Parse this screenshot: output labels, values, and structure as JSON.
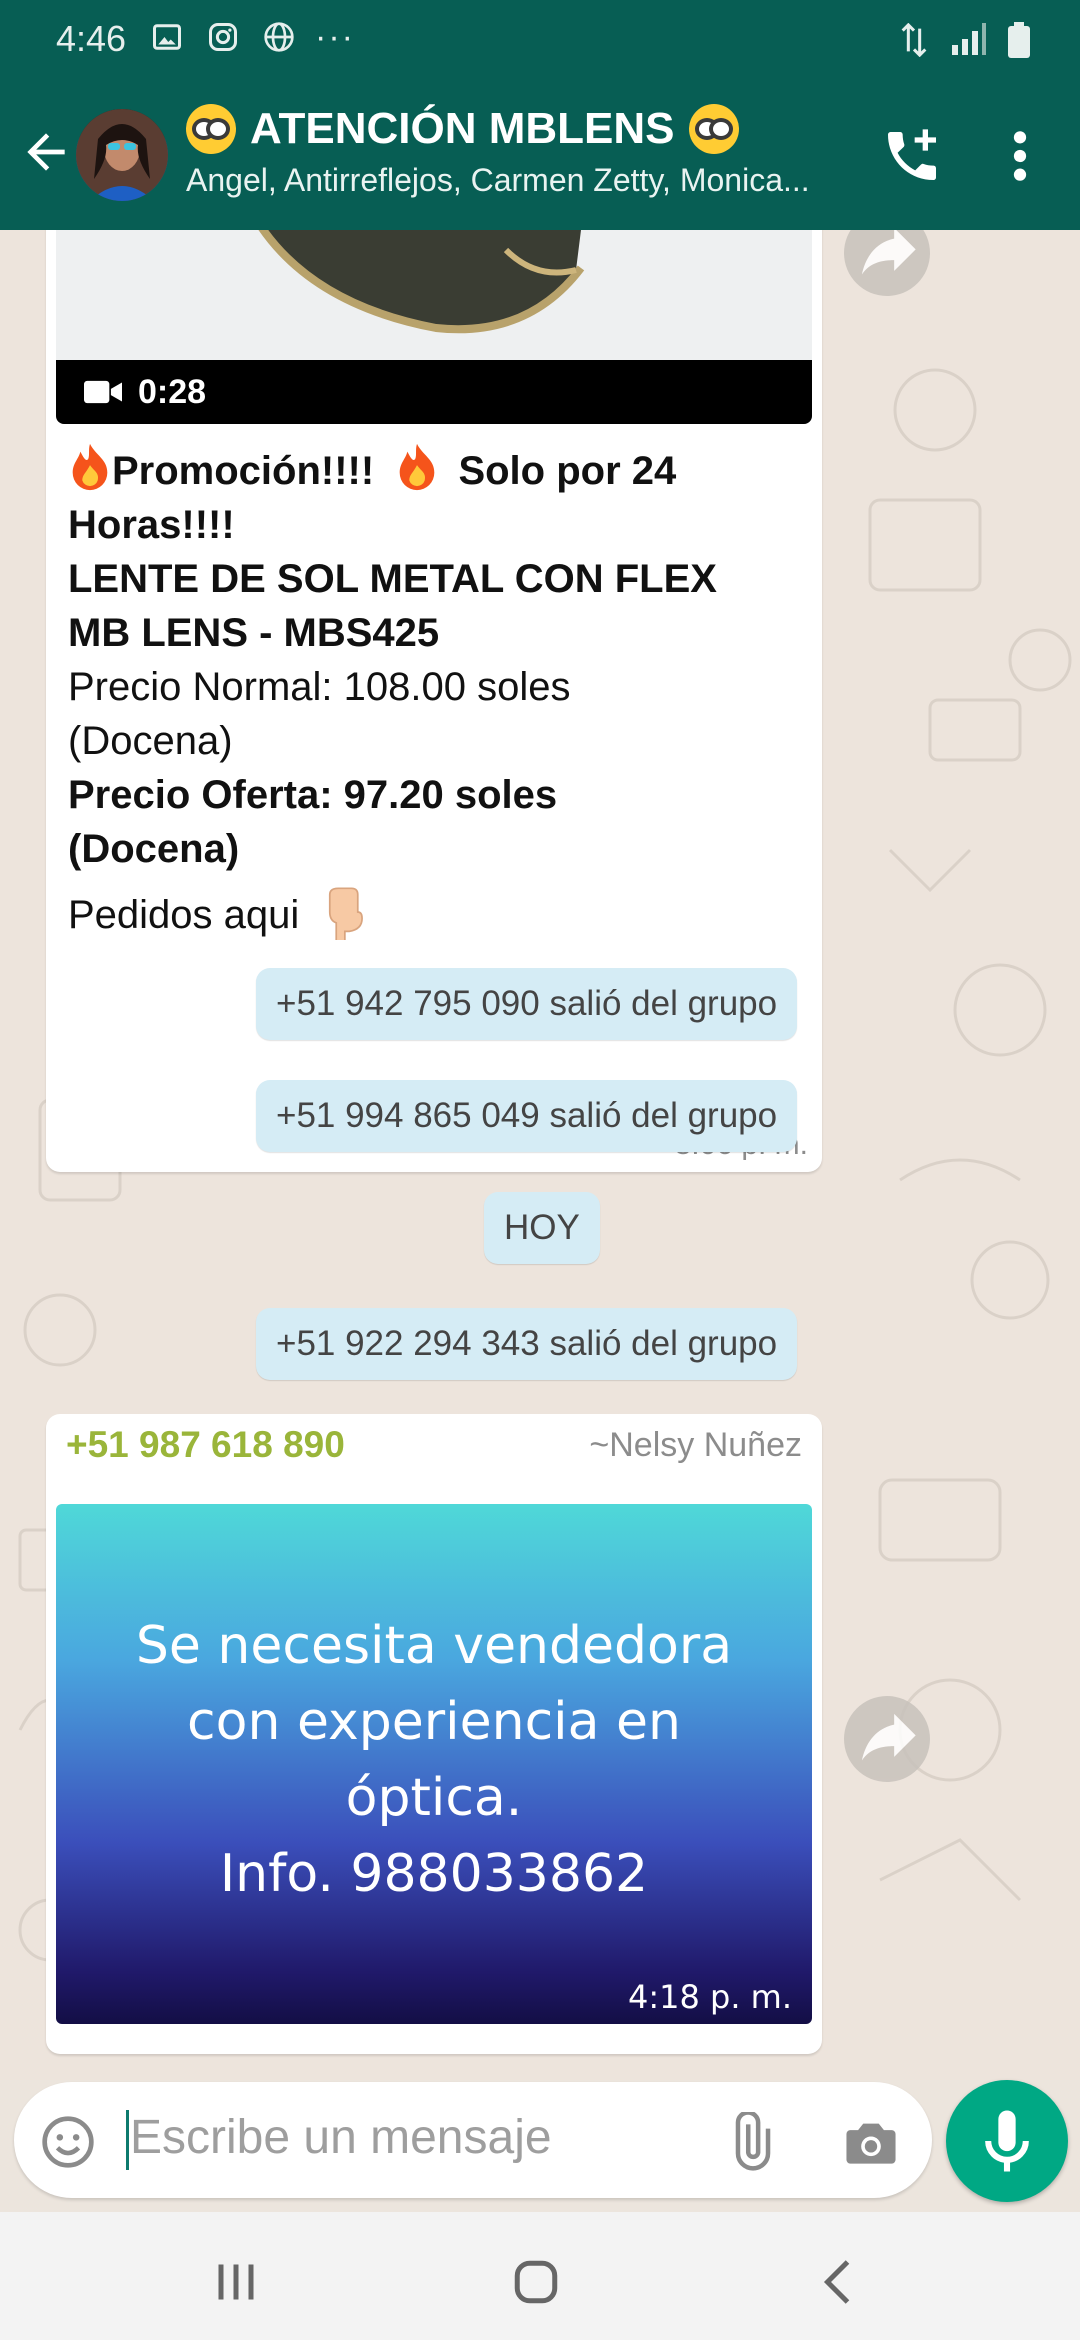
{
  "status_bar": {
    "time": "4:46",
    "more": "···"
  },
  "header": {
    "title": "ATENCIÓN  MBLENS",
    "participants": "Angel, Antirreflejos, Carmen Zetty, Monica..."
  },
  "messages": {
    "video_msg": {
      "duration": "0:28",
      "line1a": "Promoción!!!!",
      "line1b": "Solo por 24",
      "line2": "Horas!!!!",
      "line3": "LENTE DE SOL METAL CON FLEX",
      "line4": "MB LENS - MBS425",
      "line5": "Precio Normal: 108.00 soles",
      "line6": "(Docena)",
      "line7": "Precio Oferta: 97.20 soles",
      "line8": "(Docena)",
      "line9": "Pedidos aqui",
      "time": "8:06 p. m."
    },
    "system1": "+51 942 795 090 salió del grupo",
    "system2": "+51 994 865 049 salió del grupo",
    "date_chip": "HOY",
    "system3": "+51 922 294 343 salió del grupo",
    "image_msg": {
      "sender_phone": "+51 987 618 890",
      "sender_name": "~Nelsy  Nuñez",
      "image_lines": [
        "Se necesita vendedora",
        "con experiencia en",
        "óptica.",
        "Info. 988033862"
      ],
      "time": "4:18 p. m."
    }
  },
  "composer": {
    "placeholder": "Escribe un mensaje"
  },
  "colors": {
    "header": "#075e54",
    "accent": "#00a884",
    "system_bubble": "#d5ecf5",
    "sender_name": "#9ab53a"
  },
  "icons": [
    "back-arrow-icon",
    "add-call-icon",
    "more-vert-icon",
    "forward-icon",
    "video-camera-icon",
    "fire-emoji-icon",
    "pointing-down-emoji-icon",
    "emoji-icon",
    "attach-icon",
    "camera-icon",
    "mic-icon",
    "recent-apps-icon",
    "home-icon",
    "nav-back-icon"
  ]
}
